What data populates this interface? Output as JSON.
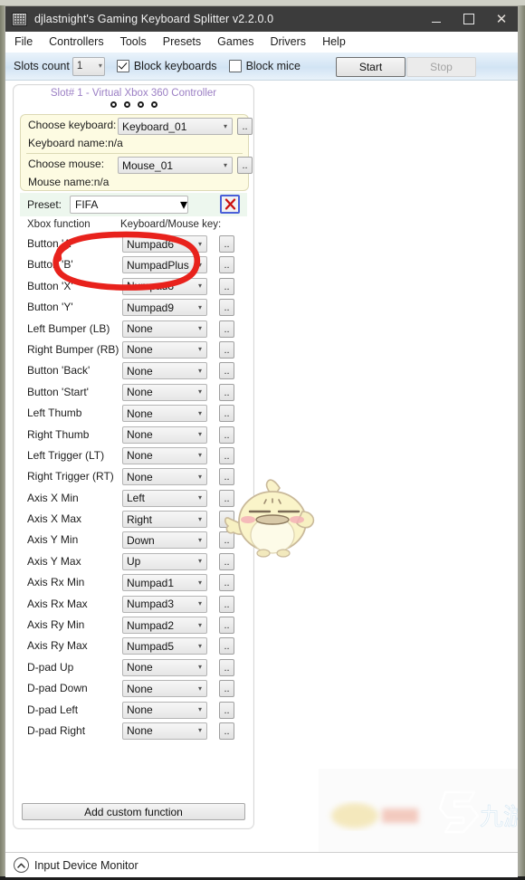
{
  "window": {
    "title": "djlastnight's Gaming Keyboard Splitter v2.2.0.0",
    "icon": "keyboard-icon",
    "minimize": "–",
    "maximize": "□",
    "close": "X"
  },
  "menubar": {
    "items": [
      "File",
      "Controllers",
      "Tools",
      "Presets",
      "Games",
      "Drivers",
      "Help"
    ]
  },
  "toolbar": {
    "slots_label": "Slots count",
    "slots_value": "1",
    "block_keyboards_label": "Block keyboards",
    "block_keyboards_checked": true,
    "block_mice_label": "Block mice",
    "block_mice_checked": false,
    "start_label": "Start",
    "stop_label": "Stop",
    "stop_disabled": true
  },
  "slot": {
    "title": "Slot# 1 - Virtual Xbox 360 Controller",
    "indicator_dots": 4,
    "device": {
      "keyboard_label": "Choose keyboard:",
      "keyboard_value": "Keyboard_01",
      "keyboard_name_label": "Keyboard name:",
      "keyboard_name_value": "n/a",
      "mouse_label": "Choose mouse:",
      "mouse_value": "Mouse_01",
      "mouse_name_label": "Mouse name:",
      "mouse_name_value": "n/a",
      "browse_label": ".."
    },
    "preset": {
      "label": "Preset:",
      "value": "FIFA",
      "delete_icon": "red-x-icon"
    },
    "table": {
      "col_function": "Xbox function",
      "col_key": "Keyboard/Mouse key:",
      "browse_label": "..",
      "rows": [
        {
          "function": "Button 'A'",
          "key": "Numpad6"
        },
        {
          "function": "Button 'B'",
          "key": "NumpadPlus"
        },
        {
          "function": "Button 'X'",
          "key": "Numpad8"
        },
        {
          "function": "Button 'Y'",
          "key": "Numpad9"
        },
        {
          "function": "Left Bumper (LB)",
          "key": "None"
        },
        {
          "function": "Right Bumper (RB)",
          "key": "None"
        },
        {
          "function": "Button 'Back'",
          "key": "None"
        },
        {
          "function": "Button 'Start'",
          "key": "None"
        },
        {
          "function": "Left Thumb",
          "key": "None"
        },
        {
          "function": "Right Thumb",
          "key": "None"
        },
        {
          "function": "Left Trigger (LT)",
          "key": "None"
        },
        {
          "function": "Right Trigger (RT)",
          "key": "None"
        },
        {
          "function": "Axis X Min",
          "key": "Left"
        },
        {
          "function": "Axis X Max",
          "key": "Right"
        },
        {
          "function": "Axis Y Min",
          "key": "Down"
        },
        {
          "function": "Axis Y Max",
          "key": "Up"
        },
        {
          "function": "Axis Rx Min",
          "key": "Numpad1"
        },
        {
          "function": "Axis Rx Max",
          "key": "Numpad3"
        },
        {
          "function": "Axis Ry Min",
          "key": "Numpad2"
        },
        {
          "function": "Axis Ry Max",
          "key": "Numpad5"
        },
        {
          "function": "D-pad Up",
          "key": "None"
        },
        {
          "function": "D-pad Down",
          "key": "None"
        },
        {
          "function": "D-pad Left",
          "key": "None"
        },
        {
          "function": "D-pad Right",
          "key": "None"
        }
      ]
    },
    "add_custom_label": "Add custom function"
  },
  "statusbar": {
    "expander_icon": "chevron-up-icon",
    "label": "Input Device Monitor"
  },
  "overlays": {
    "annotation": "red-circle-annotation",
    "sticker": "chick-sticker",
    "watermark_text": "九游"
  },
  "colors": {
    "titlebar": "#3c3c3c",
    "toolbar_top": "#eaf3fb",
    "toolbar_bottom": "#d2e4f4",
    "slot_title": "#9b7fc4",
    "device_panel": "#fdfbe2",
    "preset_strip": "#edf7ee",
    "annotation_red": "#e8221c",
    "desktop": "#8d8f7d"
  }
}
